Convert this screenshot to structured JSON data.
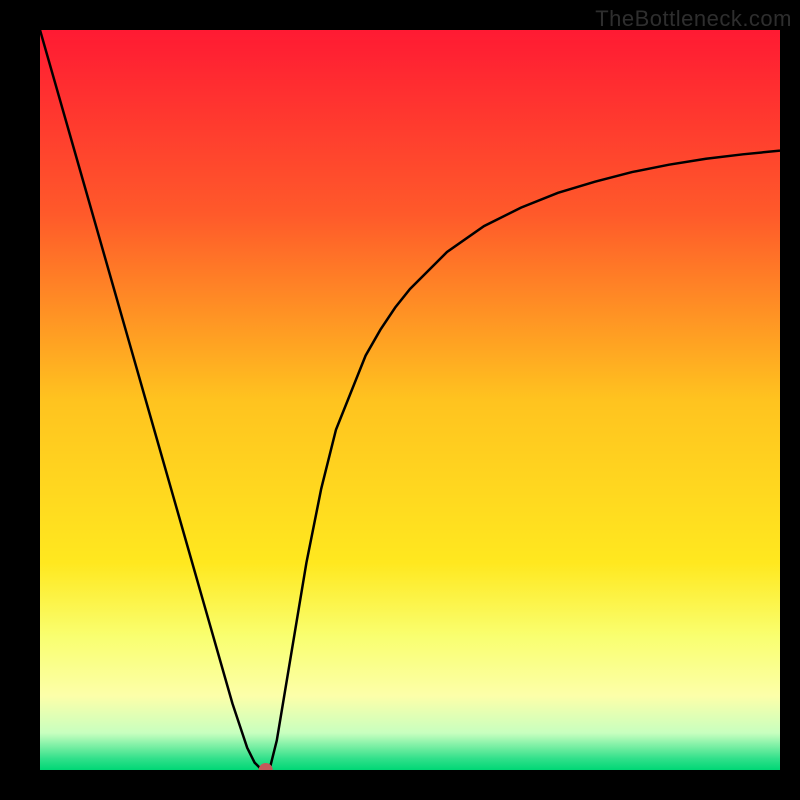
{
  "watermark": "TheBottleneck.com",
  "chart_data": {
    "type": "line",
    "title": "",
    "xlabel": "",
    "ylabel": "",
    "xlim": [
      0,
      100
    ],
    "ylim": [
      0,
      100
    ],
    "background_gradient": {
      "stops": [
        {
          "pos": 0.0,
          "color": "#ff1a33"
        },
        {
          "pos": 0.25,
          "color": "#ff5a2a"
        },
        {
          "pos": 0.5,
          "color": "#ffc31f"
        },
        {
          "pos": 0.72,
          "color": "#ffe81f"
        },
        {
          "pos": 0.82,
          "color": "#f9ff70"
        },
        {
          "pos": 0.9,
          "color": "#fcffa9"
        },
        {
          "pos": 0.95,
          "color": "#c8ffbf"
        },
        {
          "pos": 0.985,
          "color": "#30e08a"
        },
        {
          "pos": 1.0,
          "color": "#00d775"
        }
      ]
    },
    "series": [
      {
        "name": "curve",
        "color": "#000000",
        "x": [
          0,
          2,
          4,
          6,
          8,
          10,
          12,
          14,
          16,
          18,
          20,
          22,
          24,
          26,
          27,
          28,
          29,
          30,
          30.5,
          31,
          32,
          33,
          34,
          35,
          36,
          38,
          40,
          42,
          44,
          46,
          48,
          50,
          55,
          60,
          65,
          70,
          75,
          80,
          85,
          90,
          95,
          100
        ],
        "y": [
          100,
          93,
          86,
          79,
          72,
          65,
          58,
          51,
          44,
          37,
          30,
          23,
          16,
          9,
          6,
          3,
          1,
          0,
          0,
          0,
          4,
          10,
          16,
          22,
          28,
          38,
          46,
          51,
          56,
          59.5,
          62.5,
          65,
          70,
          73.5,
          76,
          78,
          79.5,
          80.8,
          81.8,
          82.6,
          83.2,
          83.7
        ]
      }
    ],
    "marker": {
      "x": 30.5,
      "y": 0,
      "color": "#c45a5a",
      "radius_px": 7
    }
  }
}
